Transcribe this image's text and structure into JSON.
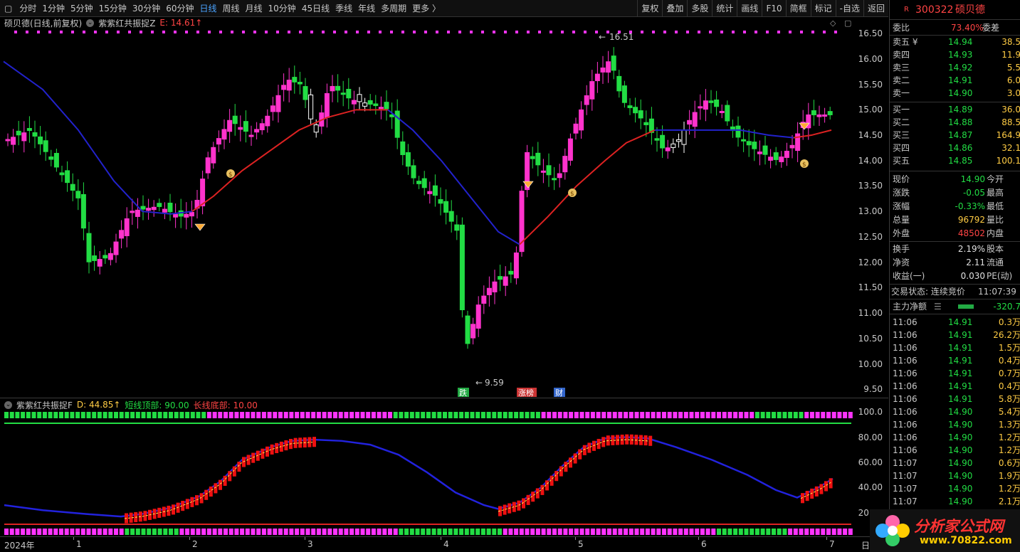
{
  "toolbar": {
    "periods": [
      "分时",
      "1分钟",
      "5分钟",
      "15分钟",
      "30分钟",
      "60分钟",
      "日线",
      "周线",
      "月线",
      "10分钟",
      "45日线",
      "季线",
      "年线",
      "多周期",
      "更多 〉"
    ],
    "active_period": "日线",
    "actions": [
      "复权",
      "叠加",
      "多股",
      "统计",
      "画线",
      "F10",
      "简框",
      "标记",
      "-自选",
      "返回"
    ]
  },
  "main_chart": {
    "stock_label": "硕贝德(日线,前复权)",
    "indicator_name": "紫紫红共振捉Z",
    "indicator_value": "E: 14.61↑",
    "y_ticks": [
      "16.50",
      "16.00",
      "15.50",
      "15.00",
      "14.50",
      "14.00",
      "13.50",
      "13.00",
      "12.50",
      "12.00",
      "11.50",
      "11.00",
      "10.50",
      "10.00",
      "9.50"
    ],
    "high_marker": "16.51",
    "low_marker": "9.59",
    "event_tags": [
      {
        "text": "跌",
        "color": "#22aa44"
      },
      {
        "text": "涨榜",
        "color": "#cc3333"
      },
      {
        "text": "财",
        "color": "#3366cc"
      }
    ]
  },
  "sub_chart": {
    "indicator_name": "紫紫红共振捉F",
    "d_value": "D: 44.85↑",
    "short_top": "短线顶部: 90.00",
    "long_bottom": "长线底部: 10.00",
    "y_ticks": [
      "100.0",
      "80.00",
      "60.00",
      "40.00",
      "20.00"
    ]
  },
  "x_axis": {
    "labels": [
      "2024年",
      "1",
      "2",
      "3",
      "4",
      "5",
      "6",
      "7"
    ],
    "right_label": "日"
  },
  "quote": {
    "code": "300322",
    "name": "硕贝德",
    "badge": "R",
    "ratio_label": "委比",
    "ratio_value": "73.40%",
    "diff_label": "委差",
    "sells": [
      {
        "label": "卖五 ¥",
        "price": "14.94",
        "vol": "38.5"
      },
      {
        "label": "卖四",
        "price": "14.93",
        "vol": "11.9"
      },
      {
        "label": "卖三",
        "price": "14.92",
        "vol": "5.5"
      },
      {
        "label": "卖二",
        "price": "14.91",
        "vol": "6.0"
      },
      {
        "label": "卖一",
        "price": "14.90",
        "vol": "3.0"
      }
    ],
    "buys": [
      {
        "label": "买一",
        "price": "14.89",
        "vol": "36.0"
      },
      {
        "label": "买二",
        "price": "14.88",
        "vol": "88.5"
      },
      {
        "label": "买三",
        "price": "14.87",
        "vol": "164.9"
      },
      {
        "label": "买四",
        "price": "14.86",
        "vol": "32.1"
      },
      {
        "label": "买五",
        "price": "14.85",
        "vol": "100.1"
      }
    ],
    "stats": [
      {
        "l": "现价",
        "v": "14.90",
        "r": "今开",
        "c": "dn"
      },
      {
        "l": "涨跌",
        "v": "-0.05",
        "r": "最高",
        "c": "dn"
      },
      {
        "l": "涨幅",
        "v": "-0.33%",
        "r": "最低",
        "c": "dn"
      },
      {
        "l": "总量",
        "v": "96792",
        "r": "量比",
        "c": "yel"
      },
      {
        "l": "外盘",
        "v": "48502",
        "r": "内盘",
        "c": "up"
      }
    ],
    "stats2": [
      {
        "l": "换手",
        "v": "2.19%",
        "r": "股本"
      },
      {
        "l": "净资",
        "v": "2.11",
        "r": "流通"
      },
      {
        "l": "收益(一)",
        "v": "0.030",
        "r": "PE(动)"
      }
    ],
    "trade_status": "交易状态: 连续竞价",
    "trade_time": "11:07:39",
    "main_flow_label": "主力净额",
    "main_flow_value": "-320.7",
    "ticks": [
      {
        "t": "11:06",
        "p": "14.91",
        "v": "0.3万"
      },
      {
        "t": "11:06",
        "p": "14.91",
        "v": "26.2万"
      },
      {
        "t": "11:06",
        "p": "14.91",
        "v": "1.5万"
      },
      {
        "t": "11:06",
        "p": "14.91",
        "v": "0.4万"
      },
      {
        "t": "11:06",
        "p": "14.91",
        "v": "0.7万"
      },
      {
        "t": "11:06",
        "p": "14.91",
        "v": "0.4万"
      },
      {
        "t": "11:06",
        "p": "14.91",
        "v": "5.8万"
      },
      {
        "t": "11:06",
        "p": "14.90",
        "v": "5.4万"
      },
      {
        "t": "11:06",
        "p": "14.90",
        "v": "1.3万"
      },
      {
        "t": "11:06",
        "p": "14.90",
        "v": "1.2万"
      },
      {
        "t": "11:06",
        "p": "14.90",
        "v": "1.2万"
      },
      {
        "t": "11:07",
        "p": "14.90",
        "v": "0.6万"
      },
      {
        "t": "11:07",
        "p": "14.90",
        "v": "1.9万"
      },
      {
        "t": "11:07",
        "p": "14.90",
        "v": "1.2万"
      },
      {
        "t": "11:07",
        "p": "14.90",
        "v": "2.1万"
      }
    ]
  },
  "watermark": {
    "title": "分析家公式网",
    "url": "www.70822.com"
  },
  "colors": {
    "up": "#ff33cc",
    "down": "#22dd44",
    "ma_blue": "#2222cc",
    "ma_red": "#dd2222"
  }
}
